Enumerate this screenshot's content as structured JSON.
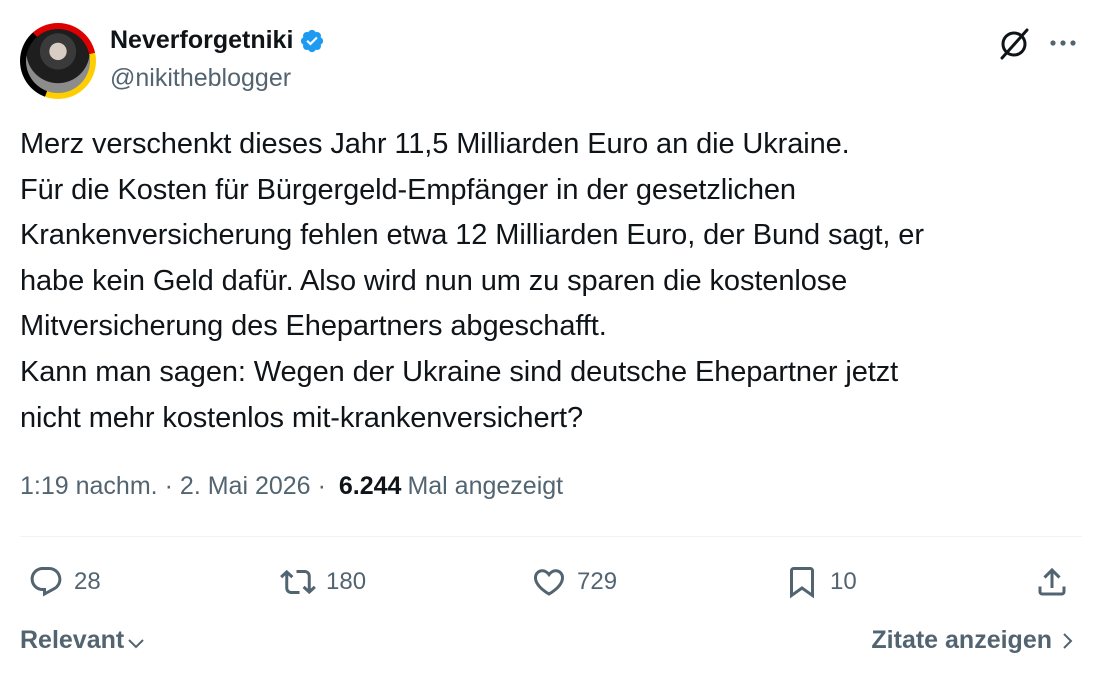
{
  "author": {
    "display_name": "Neverforgetniki",
    "handle": "@nikitheblogger",
    "verified": true
  },
  "tweet": {
    "lines": [
      "Merz verschenkt dieses Jahr 11,5 Milliarden Euro an die Ukraine.",
      "Für die Kosten für Bürgergeld-Empfänger in der gesetzlichen",
      "Krankenversicherung fehlen etwa 12 Milliarden Euro, der Bund sagt, er",
      "habe kein Geld dafür. Also wird nun um zu sparen die kostenlose",
      "Mitversicherung des Ehepartners abgeschafft.",
      "Kann man sagen: Wegen der Ukraine sind deutsche Ehepartner jetzt",
      "nicht mehr kostenlos mit-krankenversichert?"
    ]
  },
  "meta": {
    "time": "1:19 nachm.",
    "separator": "·",
    "date": "2. Mai 2026",
    "views_count": "6.244",
    "views_label": "Mal angezeigt"
  },
  "actions": {
    "replies": "28",
    "retweets": "180",
    "likes": "729",
    "bookmarks": "10"
  },
  "footer": {
    "sort_label": "Relevant",
    "quotes_label": "Zitate anzeigen"
  },
  "icons": {
    "verified": "verified-badge-icon",
    "grok": "grok-icon",
    "more": "more-icon",
    "reply": "reply-icon",
    "retweet": "retweet-icon",
    "like": "heart-icon",
    "bookmark": "bookmark-icon",
    "share": "share-icon"
  },
  "colors": {
    "text": "#0f1419",
    "secondary": "#536471",
    "verified": "#1d9bf0",
    "divider": "#eff3f4"
  }
}
